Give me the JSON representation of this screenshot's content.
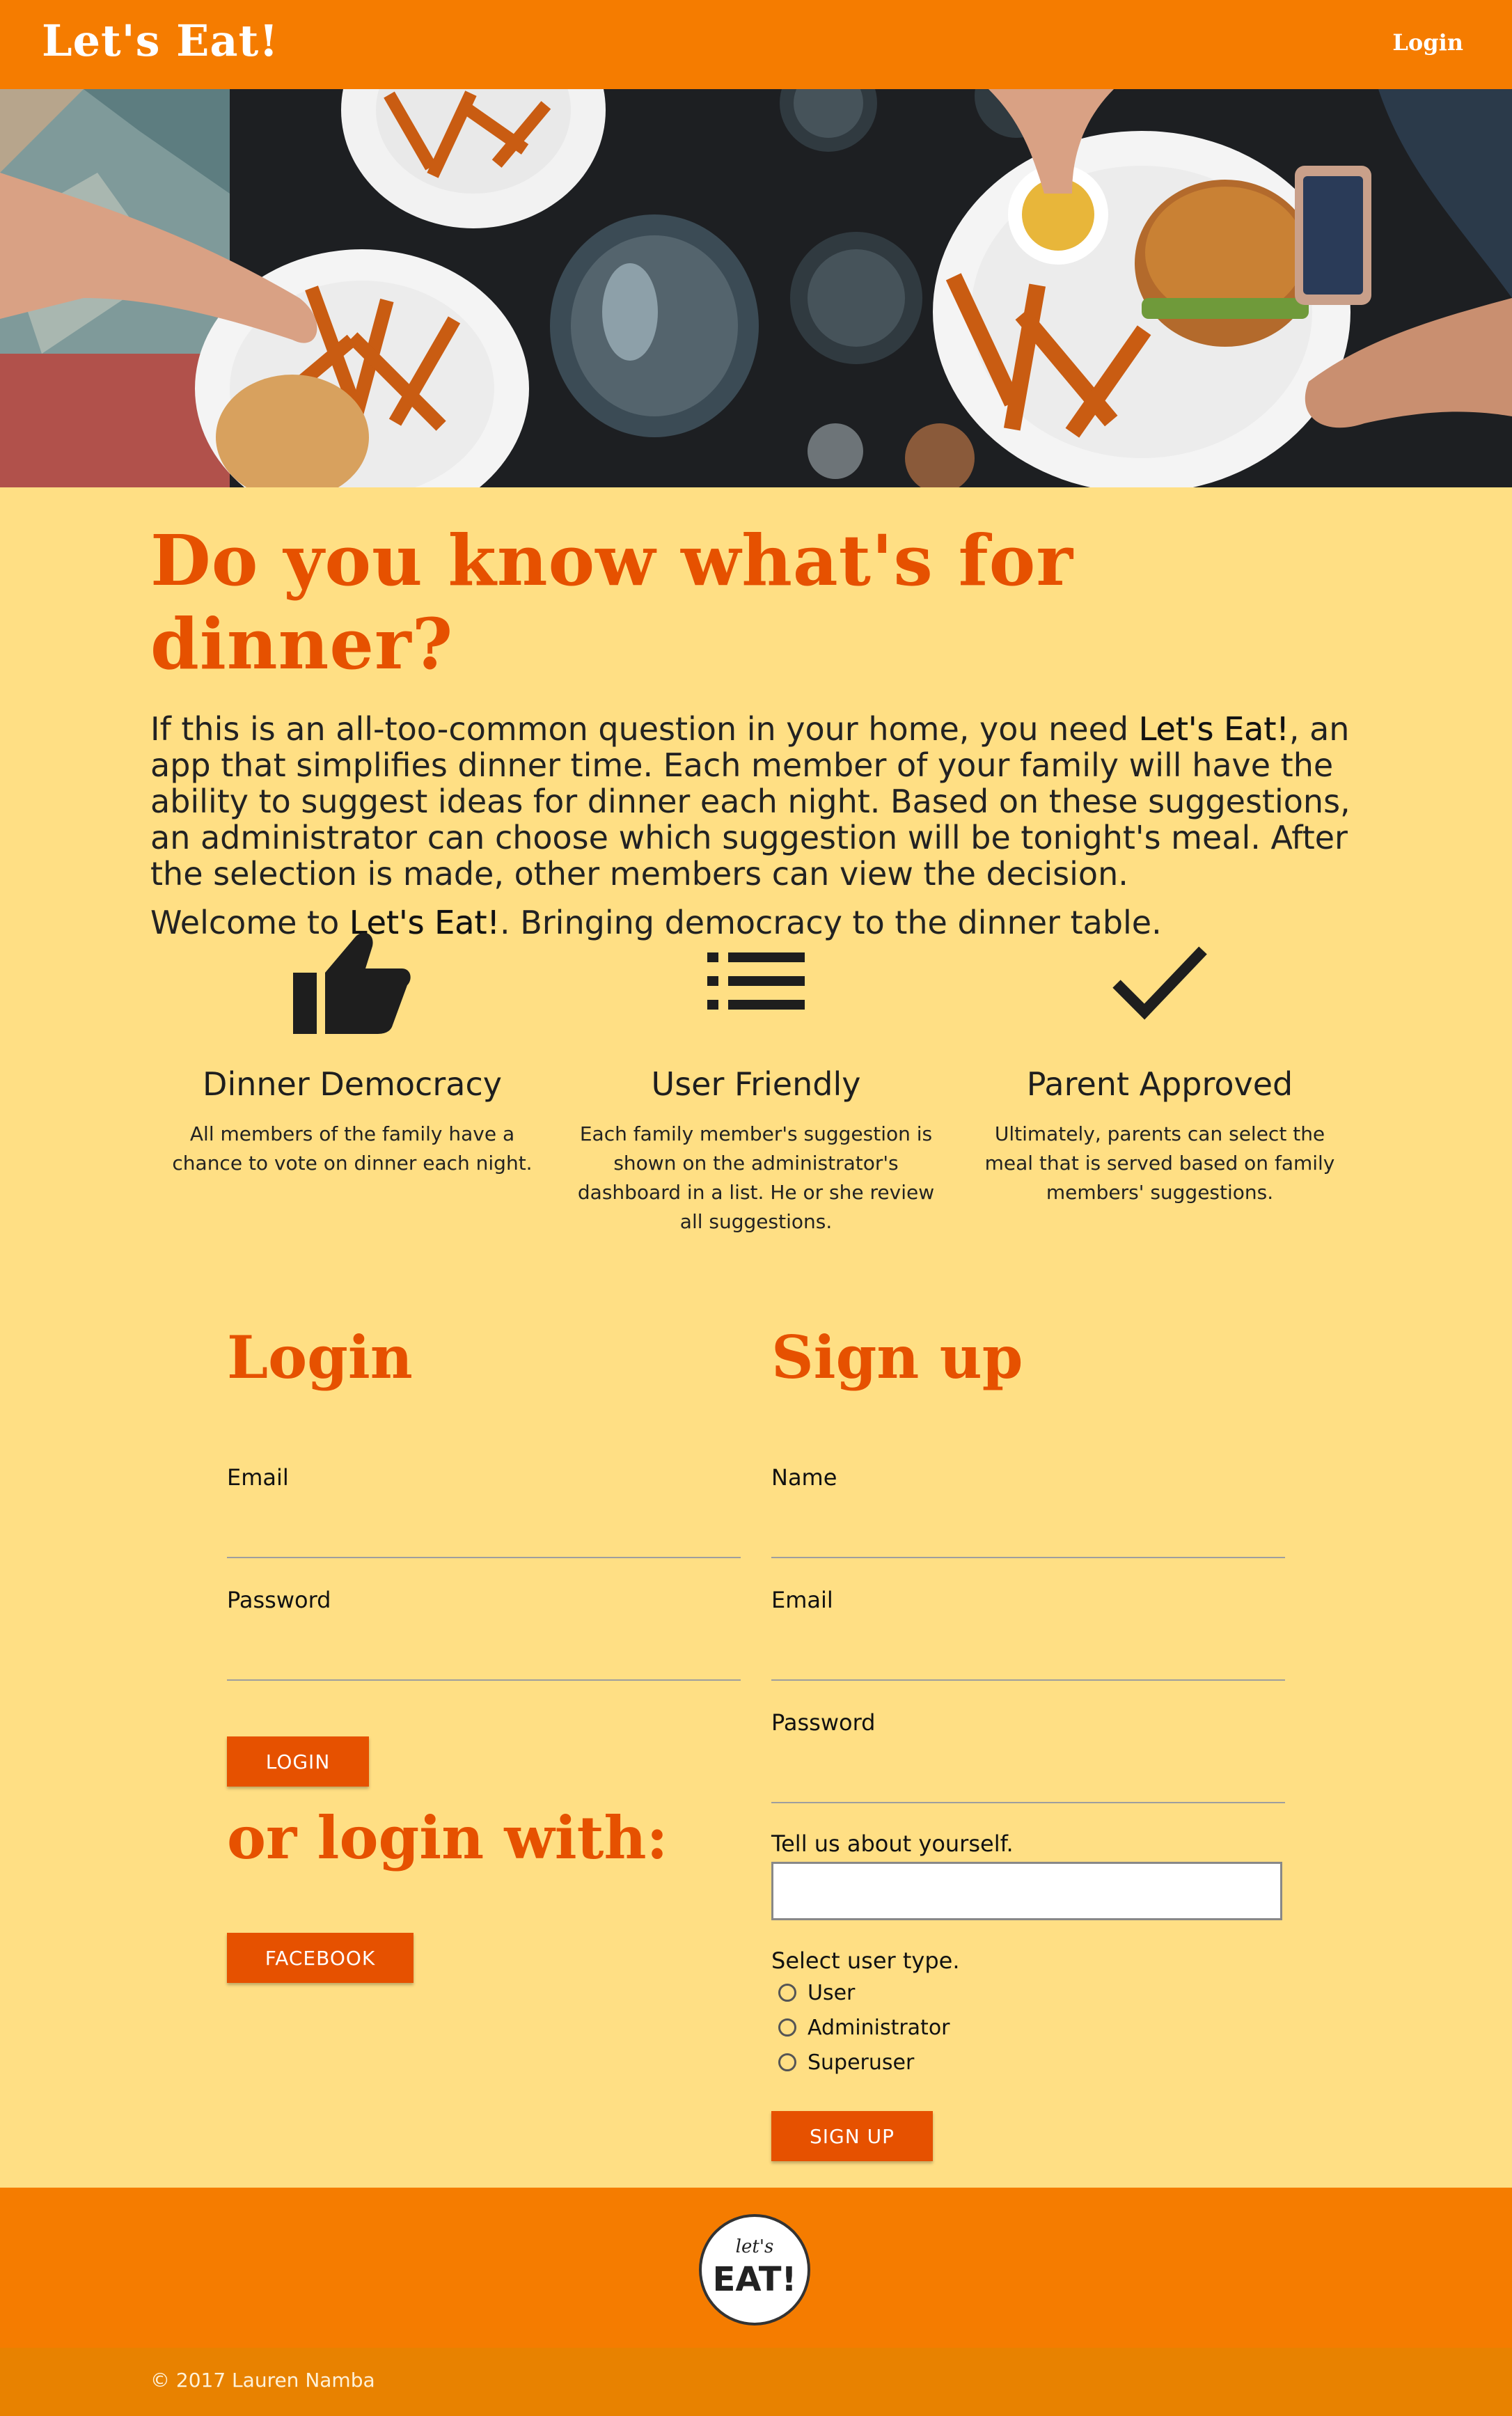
{
  "navbar": {
    "brand": "Let's Eat!",
    "login_link": "Login"
  },
  "hero": {
    "image": "dinner-table-photo"
  },
  "intro": {
    "headline": "Do you know what's for dinner?",
    "paragraph_before": "If this is an all-too-common question in your home, you need ",
    "app_name": "Let's Eat!",
    "paragraph_after": ", an app that simplifies dinner time. Each member of your family will have the ability to suggest ideas for dinner each night. Based on these suggestions, an administrator can choose which suggestion will be tonight's meal. After the selection is made, other members can view the decision.",
    "welcome_before": "Welcome to ",
    "welcome_after": ". Bringing democracy to the dinner table."
  },
  "features": [
    {
      "icon": "thumbs-up-icon",
      "title": "Dinner Democracy",
      "text": "All members of the family have a chance to vote on dinner each night."
    },
    {
      "icon": "list-icon",
      "title": "User Friendly",
      "text": "Each family member's suggestion is shown on the administrator's dashboard in a list. He or she review all suggestions."
    },
    {
      "icon": "checkmark-icon",
      "title": "Parent Approved",
      "text": "Ultimately, parents can select the meal that is served based on family members' suggestions."
    }
  ],
  "login_form": {
    "title": "Login",
    "email_label": "Email",
    "email_value": "",
    "password_label": "Password",
    "password_value": "",
    "submit_label": "LOGIN",
    "social_title": "or login with:",
    "facebook_label": "FACEBOOK"
  },
  "signup_form": {
    "title": "Sign up",
    "name_label": "Name",
    "name_value": "",
    "email_label": "Email",
    "email_value": "",
    "password_label": "Password",
    "password_value": "",
    "about_label": "Tell us about yourself.",
    "about_value": "",
    "user_type_label": "Select user type.",
    "user_types": [
      "User",
      "Administrator",
      "Superuser"
    ],
    "submit_label": "SIGN UP"
  },
  "footer": {
    "logo_top": "let's",
    "logo_bottom": "EAT!",
    "copyright": "© 2017 Lauren Namba"
  },
  "colors": {
    "navbar": "#f57c00",
    "page_background": "#ffdf84",
    "accent": "#e65100",
    "copyright_bar": "#e88200"
  }
}
